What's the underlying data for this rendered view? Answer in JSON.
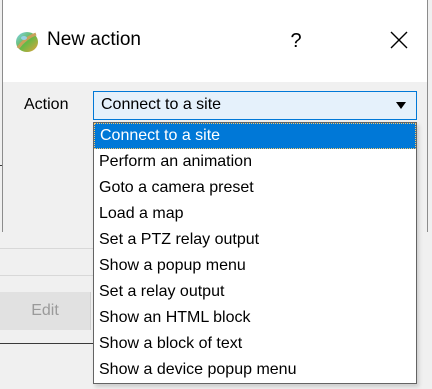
{
  "dialog": {
    "title": "New action",
    "help_label": "?",
    "action_label": "Action",
    "selected_action": "Connect to a site"
  },
  "dropdown": {
    "options": [
      "Connect to a site",
      "Perform an animation",
      "Goto a camera preset",
      "Load a map",
      "Set a PTZ relay output",
      "Show a popup menu",
      "Set a relay output",
      "Show an HTML block",
      "Show a block of text",
      "Show a device popup menu"
    ]
  },
  "background_window": {
    "edit_label": "Edit"
  },
  "colors": {
    "accent": "#0078d7",
    "select_background": "#e5f1fb",
    "window_background": "#f0f0f0"
  }
}
